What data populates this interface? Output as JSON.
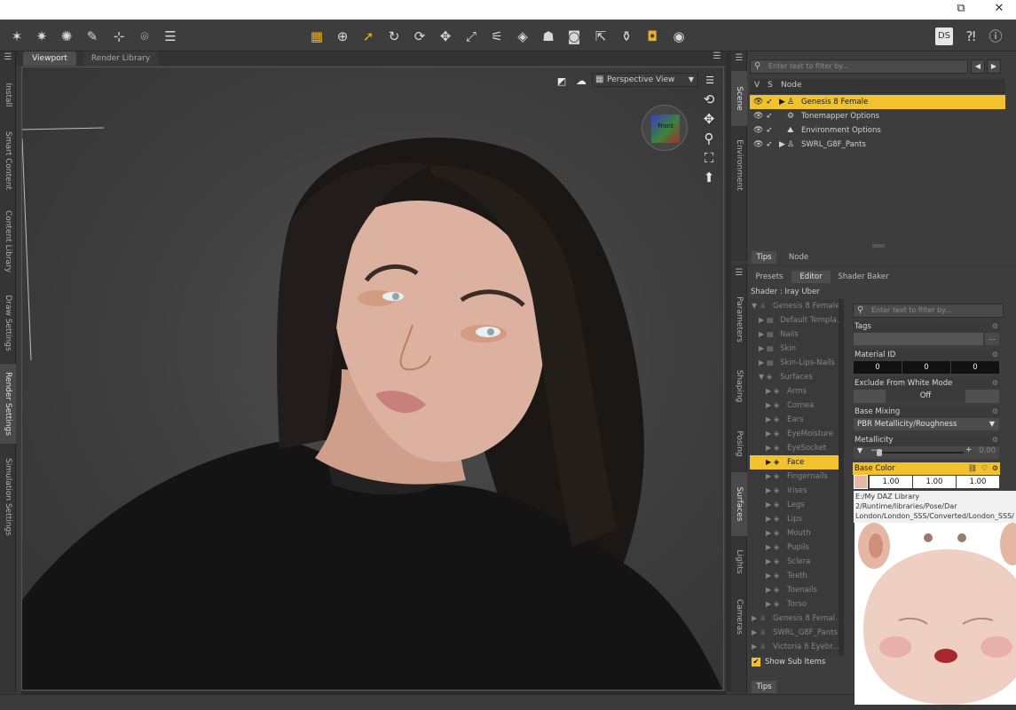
{
  "toolbar": {
    "left_tools": [
      "spark-wand-icon",
      "spark-star-icon",
      "spark-circle-icon",
      "spark-pin-icon",
      "node-add-icon",
      "node-select-icon",
      "list-align-icon"
    ],
    "center_tools": [
      "grid-tool-icon",
      "universal-move-icon",
      "pointer-icon",
      "rotate-view-icon",
      "rotate-icon",
      "translate-icon",
      "scale-icon",
      "joint-editor-icon",
      "geometry-editor-icon",
      "figure-setup-icon",
      "camera-render-icon",
      "node-pointer-icon",
      "surface-selection-icon",
      "gold-render-icon",
      "camera-icon"
    ],
    "right_tools": [
      "ds-logo-icon",
      "help-pointer-icon",
      "help-circle-icon"
    ]
  },
  "left_tabs": [
    "Install",
    "Smart Content",
    "Content Library",
    "Draw Settings",
    "Render Settings",
    "Simulation Settings"
  ],
  "viewport": {
    "tabs": [
      "Viewport",
      "Render Library"
    ],
    "view_mode": "Perspective View",
    "cube_label": "Front"
  },
  "scene_tabs": [
    "Scene",
    "Environment"
  ],
  "scene": {
    "filter_placeholder": "Enter text to filter by...",
    "columns": [
      "V",
      "S",
      "Node"
    ],
    "rows": [
      {
        "name": "Genesis 8 Female",
        "selected": true
      },
      {
        "name": "Tonemapper Options",
        "selected": false
      },
      {
        "name": "Environment Options",
        "selected": false
      },
      {
        "name": "SWRL_G8F_Pants",
        "selected": false
      }
    ],
    "bottom_tabs": [
      "Tips",
      "Node"
    ]
  },
  "surfaces_side_tabs": [
    "Parameters",
    "Shaping",
    "Posing",
    "Surfaces",
    "Lights",
    "Cameras"
  ],
  "surfaces": {
    "tabs": [
      "Presets",
      "Editor",
      "Shader Baker"
    ],
    "shader": "Shader : Iray Uber",
    "tree": [
      {
        "label": "Genesis 8 Female",
        "level": 0
      },
      {
        "label": "Default Templa...",
        "level": 1
      },
      {
        "label": "Nails",
        "level": 1
      },
      {
        "label": "Skin",
        "level": 1
      },
      {
        "label": "Skin-Lips-Nails",
        "level": 1
      },
      {
        "label": "Surfaces",
        "level": 1
      },
      {
        "label": "Arms",
        "level": 2
      },
      {
        "label": "Cornea",
        "level": 2
      },
      {
        "label": "Ears",
        "level": 2
      },
      {
        "label": "EyeMoisture",
        "level": 2
      },
      {
        "label": "EyeSocket",
        "level": 2
      },
      {
        "label": "Face",
        "level": 2,
        "selected": true
      },
      {
        "label": "Fingernails",
        "level": 2
      },
      {
        "label": "Irises",
        "level": 2
      },
      {
        "label": "Legs",
        "level": 2
      },
      {
        "label": "Lips",
        "level": 2
      },
      {
        "label": "Mouth",
        "level": 2
      },
      {
        "label": "Pupils",
        "level": 2
      },
      {
        "label": "Sclera",
        "level": 2
      },
      {
        "label": "Teeth",
        "level": 2
      },
      {
        "label": "Toenails",
        "level": 2
      },
      {
        "label": "Torso",
        "level": 2
      },
      {
        "label": "Genesis 8 Femal...",
        "level": 0
      },
      {
        "label": "SWRL_G8F_Pants",
        "level": 0
      },
      {
        "label": "Victoria 8 Eyebr...",
        "level": 0
      }
    ],
    "show_sub_items": "Show Sub Items",
    "bottom_tab": "Tips",
    "prop_filter_placeholder": "Enter text to filter by...",
    "props": {
      "tags_label": "Tags",
      "tags_button": "...",
      "material_id_label": "Material ID",
      "material_id": [
        "0",
        "0",
        "0"
      ],
      "exclude_label": "Exclude From White Mode",
      "exclude_value": "Off",
      "base_mixing_label": "Base Mixing",
      "base_mixing_value": "PBR Metallicity/Roughness",
      "metallicity_label": "Metallicity",
      "metallicity_value": "0.00",
      "metallicity_level": 0.0,
      "base_color_label": "Base Color",
      "base_color_values": [
        "1.00",
        "1.00",
        "1.00"
      ],
      "texture_path": "E:/My DAZ Library 2/Runtime/libraries/Pose/Dar London/London_SSS/Converted/London_SSS/ Transformed_Head_Colo_NB.jpg"
    }
  },
  "colors": {
    "selection": "#f2c12e",
    "panel": "#3d3d3d",
    "toolbar": "#3d3d3d"
  }
}
